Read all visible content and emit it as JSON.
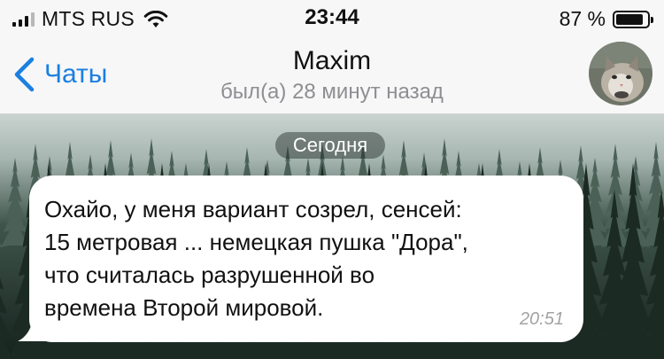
{
  "status_bar": {
    "carrier": "MTS RUS",
    "time": "23:44",
    "battery_percent": "87 %",
    "battery_level": 0.87,
    "signal_bars": 4,
    "signal_bars_filled": 3
  },
  "header": {
    "back_label": "Чаты",
    "title": "Maxim",
    "subtitle": "был(а) 28 минут назад"
  },
  "chat": {
    "date_label": "Сегодня",
    "messages": [
      {
        "lines": [
          "Охайо, у меня вариант созрел, сенсей:",
          "15 метровая ... немецкая пушка \"Дора\",",
          "что считалась разрушенной во",
          "времена Второй мировой."
        ],
        "time": "20:51"
      }
    ]
  },
  "colors": {
    "accent": "#1a7fe0",
    "bubble": "#ffffff",
    "subtitle": "#8e8e93",
    "time_text": "#a3a3a3"
  },
  "icons": {
    "back": "chevron-left-icon",
    "wifi": "wifi-icon",
    "battery": "battery-icon",
    "signal": "signal-icon"
  }
}
